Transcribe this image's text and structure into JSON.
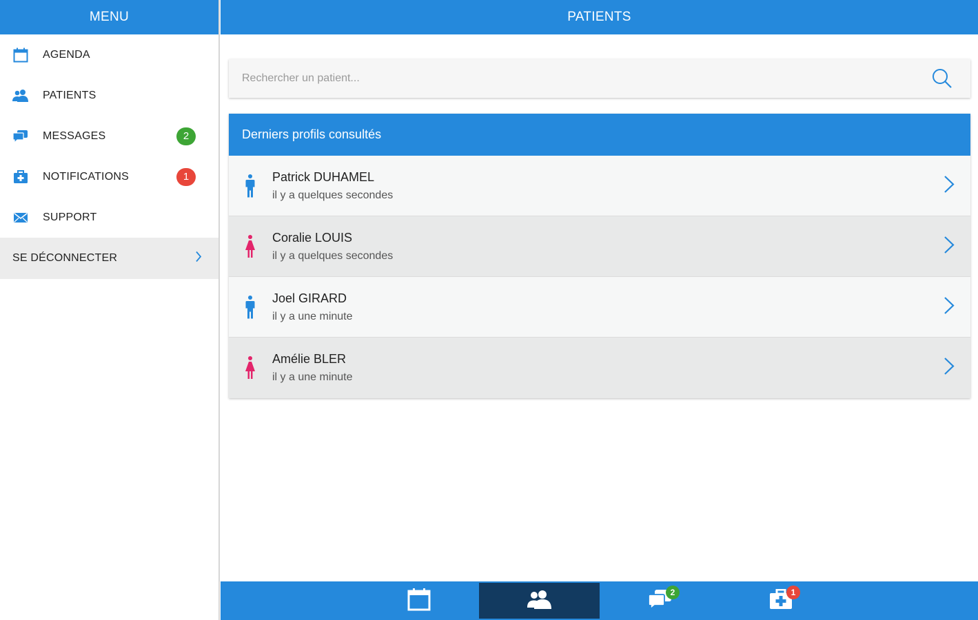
{
  "sidebar": {
    "title": "MENU",
    "items": [
      {
        "label": "AGENDA",
        "icon": "calendar-icon"
      },
      {
        "label": "PATIENTS",
        "icon": "users-icon"
      },
      {
        "label": "MESSAGES",
        "icon": "chat-icon",
        "badge": "2"
      },
      {
        "label": "NOTIFICATIONS",
        "icon": "medkit-icon",
        "badge": "1"
      },
      {
        "label": "SUPPORT",
        "icon": "envelope-icon"
      }
    ],
    "logout_label": "SE DÉCONNECTER"
  },
  "header": {
    "title": "PATIENTS"
  },
  "search": {
    "placeholder": "Rechercher un patient..."
  },
  "recent": {
    "title": "Derniers profils consultés",
    "patients": [
      {
        "name": "Patrick DUHAMEL",
        "time": "il y a quelques secondes",
        "gender": "male"
      },
      {
        "name": "Coralie LOUIS",
        "time": "il y a quelques secondes",
        "gender": "female"
      },
      {
        "name": "Joel GIRARD",
        "time": "il y a une minute",
        "gender": "male"
      },
      {
        "name": "Amélie BLER",
        "time": "il y a une minute",
        "gender": "female"
      }
    ]
  },
  "bottom_nav": {
    "items": [
      {
        "icon": "calendar-icon"
      },
      {
        "icon": "users-icon",
        "active": true
      },
      {
        "icon": "chat-icon",
        "badge": "2"
      },
      {
        "icon": "medkit-icon",
        "badge": "1"
      }
    ]
  },
  "colors": {
    "primary": "#2589dc",
    "active_nav": "#123a60",
    "badge_green": "#3da535",
    "badge_red": "#e8463a",
    "male": "#2589dc",
    "female": "#e3256b"
  }
}
